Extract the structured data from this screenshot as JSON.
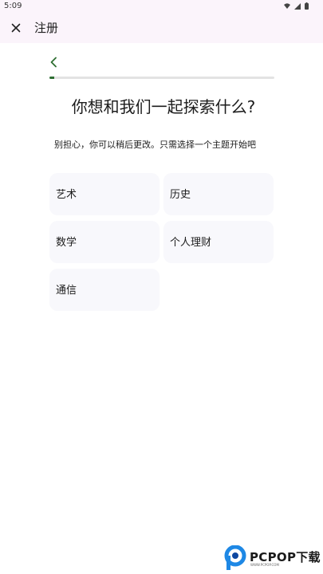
{
  "status_bar": {
    "time": "5:09"
  },
  "app_bar": {
    "title": "注册"
  },
  "progress": {
    "value": 0.02
  },
  "heading": "你想和我们一起探索什么?",
  "subtitle": "别担心，你可以稍后更改。只需选择一个主题开始吧",
  "topics": [
    {
      "label": "艺术"
    },
    {
      "label": "历史"
    },
    {
      "label": "数学"
    },
    {
      "label": "个人理财"
    },
    {
      "label": "通信"
    }
  ],
  "watermark": {
    "text": "PCPOP下载",
    "sub": "WWW.PCPOP.COM"
  },
  "colors": {
    "accent": "#2e6e32",
    "app_bar_bg": "#fbf4fb",
    "card_bg": "#f8f8fc"
  }
}
